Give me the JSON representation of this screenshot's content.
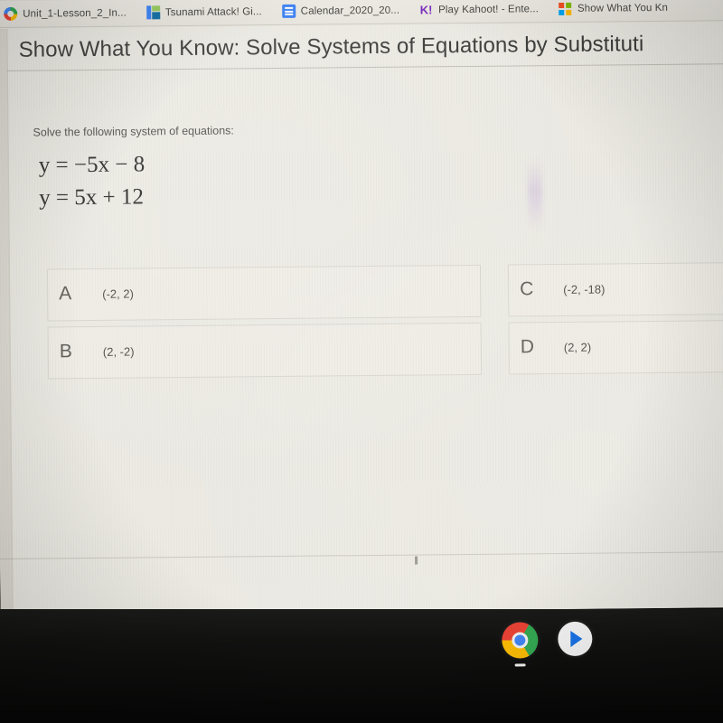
{
  "browser": {
    "chrome_strip_ghost_text": "········ ···",
    "bookmarks": [
      {
        "icon": "google-classroom-icon",
        "label": "Unit_1-Lesson_2_In..."
      },
      {
        "icon": "google-slides-icon",
        "label": "Tsunami Attack! Gi..."
      },
      {
        "icon": "google-docs-icon",
        "label": "Calendar_2020_20..."
      },
      {
        "icon": "kahoot-icon",
        "label": "Play Kahoot! - Ente...",
        "glyph": "K!"
      },
      {
        "icon": "microsoft-icon",
        "label": "Show What You Kn"
      }
    ]
  },
  "page": {
    "title": "Show What You Know: Solve Systems of Equations by Substituti",
    "prompt": "Solve the following system of equations:",
    "equations": [
      {
        "lhs": "y",
        "op": "=",
        "rhs": "−5x − 8"
      },
      {
        "lhs": "y",
        "op": "=",
        "rhs": "5x + 12"
      }
    ],
    "equations_plain": [
      "y = −5x − 8",
      "y = 5x + 12"
    ],
    "choices": [
      {
        "letter": "A",
        "value": "(-2, 2)"
      },
      {
        "letter": "B",
        "value": "(2, -2)"
      },
      {
        "letter": "C",
        "value": "(-2, -18)"
      },
      {
        "letter": "D",
        "value": "(2, 2)"
      }
    ]
  },
  "shelf": {
    "items": [
      {
        "icon": "chrome-icon",
        "label": "Google Chrome",
        "active": true
      },
      {
        "icon": "google-play-icon",
        "label": "Play Store",
        "active": false
      }
    ]
  },
  "colors": {
    "page_background": "#eceae3",
    "bookmark_bar": "#efece6",
    "shelf": "#111110",
    "title_text": "#3d3d3b",
    "kahoot_purple": "#7b2fbe"
  }
}
